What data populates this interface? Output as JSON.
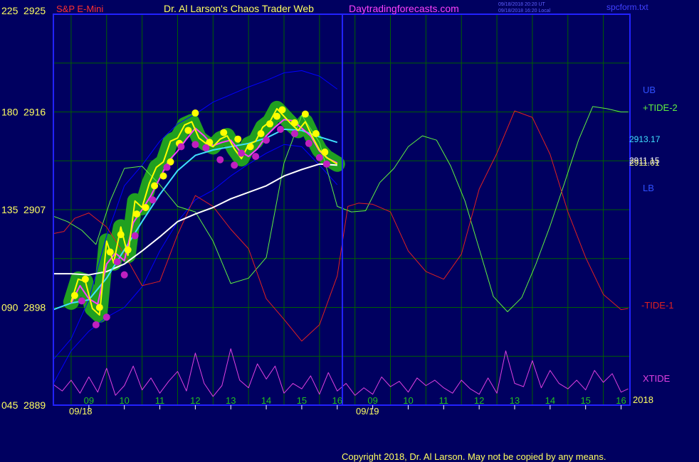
{
  "header": {
    "left_axis_top": "225",
    "price_top": "2925",
    "instrument": "S&P E-Mini",
    "title": "Dr. Al Larson's Chaos Trader Web",
    "site": "Daytradingforecasts.com",
    "timestamp_line1": "09/18/2018 20:20 UT",
    "timestamp_line2": "09/18/2018 16:20 Local",
    "filename": "spcform.txt"
  },
  "footer": {
    "copyright": "Copyright 2018, Dr. Al Larson. May not be copied by any means."
  },
  "colors": {
    "background": "#000060",
    "grid": "#006000",
    "frame": "#2222ff",
    "price": "#ffff00",
    "fast_avg": "#ff40ff",
    "cyan_avg": "#40e0ff",
    "white_avg": "#ffffff",
    "band": "#0000ff",
    "tide_plus": "#60f040",
    "tide_minus": "#e02020",
    "xtide": "#e040e0",
    "halo": "#20a020",
    "dot_yellow": "#ffff00",
    "dot_magenta": "#c020c0"
  },
  "chart_data": {
    "type": "line",
    "title": "S&P E-Mini",
    "y_left_ticks": [
      {
        "angle": "225",
        "price": "2925",
        "value": 2925
      },
      {
        "angle": "180",
        "price": "2916",
        "value": 2916
      },
      {
        "angle": "135",
        "price": "2907",
        "value": 2907
      },
      {
        "angle": "090",
        "price": "2898",
        "value": 2898
      },
      {
        "angle": "045",
        "price": "2889",
        "value": 2889
      }
    ],
    "ylim": [
      2889,
      2925
    ],
    "x_hour_ticks": [
      "09",
      "10",
      "11",
      "12",
      "13",
      "14",
      "15",
      "16",
      "09",
      "10",
      "11",
      "12",
      "13",
      "14",
      "15",
      "16"
    ],
    "x_dates": [
      "09/18",
      "09/19"
    ],
    "x_end_label": "2018",
    "right_labels": {
      "ub": "UB",
      "tide_plus": "+TIDE-2",
      "cyan_value": "2913.17",
      "white_value_a": "2911.15",
      "white_value_b": "2911.01",
      "lb": "LB",
      "tide_minus": "-TIDE-1",
      "xtide": "XTIDE"
    },
    "series": [
      {
        "name": "S&P E-Mini",
        "x": [
          8.5,
          8.7,
          8.9,
          9.1,
          9.3,
          9.5,
          9.7,
          9.9,
          10.1,
          10.3,
          10.5,
          10.7,
          10.9,
          11.1,
          11.3,
          11.5,
          11.7,
          11.9,
          12.1,
          12.3,
          12.5,
          12.7,
          12.9,
          13.1,
          13.3,
          13.5,
          13.7,
          13.9,
          14.1,
          14.3,
          14.5,
          14.7,
          14.9,
          15.1,
          15.3,
          15.5,
          15.7,
          15.9,
          16.0
        ],
        "values": [
          2898.5,
          2900.6,
          2900.4,
          2897.9,
          2897.3,
          2904.1,
          2902.1,
          2905.4,
          2902.8,
          2907.8,
          2907.2,
          2909.4,
          2910.9,
          2911.4,
          2913.3,
          2913.6,
          2914.8,
          2915.1,
          2913.6,
          2913.1,
          2912.8,
          2913.5,
          2913.8,
          2912.6,
          2911.7,
          2913.0,
          2913.3,
          2914.6,
          2915.1,
          2916.3,
          2915.6,
          2914.9,
          2914.3,
          2915.1,
          2913.7,
          2912.5,
          2911.8,
          2911.4,
          2911.2
        ]
      },
      {
        "name": "UB",
        "x": [
          8.0,
          8.5,
          9.0,
          9.5,
          10.0,
          10.5,
          11.0,
          11.5,
          12.0,
          12.5,
          13.0,
          13.5,
          14.0,
          14.5,
          15.0,
          15.5,
          16.0
        ],
        "values": [
          2893.2,
          2895.1,
          2898.7,
          2904.6,
          2909.2,
          2911.1,
          2913.3,
          2914.9,
          2915.8,
          2916.9,
          2917.6,
          2918.3,
          2918.9,
          2919.6,
          2919.8,
          2919.3,
          2918.1
        ]
      },
      {
        "name": "LB",
        "x": [
          8.0,
          8.5,
          9.0,
          9.5,
          10.0,
          10.5,
          11.0,
          11.5,
          12.0,
          12.5,
          13.0,
          13.5,
          14.0,
          14.5,
          15.0,
          15.5,
          16.0
        ],
        "values": [
          2891.0,
          2894.0,
          2895.8,
          2897.1,
          2898.0,
          2899.9,
          2903.2,
          2905.9,
          2907.9,
          2908.8,
          2910.1,
          2911.2,
          2912.2,
          2913.0,
          2912.8,
          2911.1,
          2909.3
        ]
      },
      {
        "name": "+TIDE-2",
        "x": [
          8.0,
          8.4,
          8.8,
          9.2,
          9.6,
          10.0,
          10.5,
          11.0,
          11.5,
          12.0,
          12.5,
          13.0,
          13.5,
          14.0,
          14.5,
          15.0,
          15.5,
          16.0,
          16.4,
          16.8,
          17.2,
          17.6,
          18.0,
          18.4,
          18.8,
          19.2,
          19.6,
          20.0,
          20.4,
          20.8,
          21.2,
          21.6,
          22.0,
          22.4,
          22.8,
          23.2,
          23.6,
          24.0,
          24.2
        ],
        "values": [
          2906.4,
          2905.9,
          2905.1,
          2903.8,
          2907.8,
          2910.8,
          2911.0,
          2909.3,
          2907.3,
          2906.8,
          2904.1,
          2900.2,
          2900.7,
          2902.6,
          2911.3,
          2915.7,
          2913.2,
          2907.3,
          2906.8,
          2906.9,
          2909.5,
          2910.8,
          2912.8,
          2913.8,
          2913.4,
          2911.0,
          2907.8,
          2903.4,
          2899.0,
          2897.6,
          2898.9,
          2902.0,
          2905.5,
          2909.4,
          2913.4,
          2916.5,
          2916.3,
          2916.0,
          2916.0
        ]
      },
      {
        "name": "-TIDE-1",
        "x": [
          8.0,
          8.3,
          8.6,
          9.0,
          9.5,
          10.0,
          10.5,
          11.0,
          11.5,
          12.0,
          12.5,
          13.0,
          13.5,
          14.0,
          14.5,
          15.0,
          15.5,
          16.0,
          16.3,
          16.6,
          17.0,
          17.5,
          18.0,
          18.5,
          19.0,
          19.5,
          20.0,
          20.5,
          21.0,
          21.5,
          22.0,
          22.5,
          23.0,
          23.5,
          24.0,
          24.2
        ],
        "values": [
          2904.8,
          2905.0,
          2906.2,
          2906.7,
          2905.4,
          2902.9,
          2900.0,
          2900.4,
          2904.7,
          2908.3,
          2907.3,
          2905.2,
          2903.4,
          2898.8,
          2896.9,
          2894.9,
          2896.4,
          2900.9,
          2907.3,
          2907.6,
          2907.5,
          2906.8,
          2903.2,
          2901.3,
          2900.6,
          2902.9,
          2908.9,
          2912.2,
          2916.1,
          2915.5,
          2912.1,
          2906.8,
          2902.6,
          2899.2,
          2897.8,
          2897.9
        ]
      },
      {
        "name": "XTIDE",
        "x": [
          8.0,
          8.25,
          8.5,
          8.75,
          9.0,
          9.25,
          9.5,
          9.75,
          10.0,
          10.25,
          10.5,
          10.75,
          11.0,
          11.25,
          11.5,
          11.75,
          12.0,
          12.25,
          12.5,
          12.75,
          13.0,
          13.25,
          13.5,
          13.75,
          14.0,
          14.25,
          14.5,
          14.75,
          15.0,
          15.25,
          15.5,
          15.75,
          16.0,
          16.25,
          16.5,
          16.75,
          17.0,
          17.25,
          17.5,
          17.75,
          18.0,
          18.25,
          18.5,
          18.75,
          19.0,
          19.25,
          19.5,
          19.75,
          20.0,
          20.25,
          20.5,
          20.75,
          21.0,
          21.25,
          21.5,
          21.75,
          22.0,
          22.25,
          22.5,
          22.75,
          23.0,
          23.25,
          23.5,
          23.75,
          24.0,
          24.2
        ],
        "values": [
          2890.9,
          2890.3,
          2891.3,
          2890.1,
          2891.6,
          2890.2,
          2892.4,
          2889.9,
          2890.8,
          2892.6,
          2890.4,
          2891.5,
          2890.1,
          2891.2,
          2892.1,
          2890.3,
          2893.8,
          2891.0,
          2889.8,
          2890.8,
          2894.2,
          2891.3,
          2890.6,
          2892.8,
          2891.4,
          2892.6,
          2890.1,
          2891.0,
          2890.5,
          2891.7,
          2890.0,
          2892.0,
          2890.3,
          2891.0,
          2889.9,
          2890.6,
          2890.0,
          2891.6,
          2890.7,
          2891.2,
          2890.2,
          2891.5,
          2890.8,
          2891.3,
          2890.6,
          2890.1,
          2891.3,
          2890.5,
          2890.0,
          2891.5,
          2890.1,
          2894.0,
          2891.0,
          2890.7,
          2893.1,
          2890.6,
          2892.2,
          2891.0,
          2890.5,
          2891.3,
          2890.4,
          2892.2,
          2891.1,
          2891.9,
          2890.2,
          2890.5
        ]
      },
      {
        "name": "cyan average",
        "x": [
          8.0,
          8.5,
          9.0,
          9.5,
          10.0,
          10.5,
          11.0,
          11.5,
          12.0,
          12.5,
          13.0,
          13.5,
          14.0,
          14.5,
          15.0,
          15.5,
          16.0
        ],
        "values": [
          2897.8,
          2898.4,
          2898.7,
          2900.7,
          2903.3,
          2905.9,
          2908.4,
          2910.6,
          2912.0,
          2912.5,
          2912.8,
          2913.1,
          2913.6,
          2914.4,
          2914.3,
          2913.7,
          2913.2
        ]
      },
      {
        "name": "white average",
        "x": [
          8.0,
          8.5,
          9.0,
          9.5,
          10.0,
          10.5,
          11.0,
          11.5,
          12.0,
          12.5,
          13.0,
          13.5,
          14.0,
          14.5,
          15.0,
          15.5,
          16.0
        ],
        "values": [
          2901.1,
          2901.1,
          2901.0,
          2901.3,
          2902.0,
          2903.2,
          2904.5,
          2905.9,
          2906.6,
          2907.2,
          2908.0,
          2908.6,
          2909.2,
          2910.1,
          2910.7,
          2911.2,
          2911.1
        ]
      },
      {
        "name": "magenta average",
        "x": [
          8.5,
          8.75,
          9.0,
          9.25,
          9.5,
          9.75,
          10.0,
          10.25,
          10.5,
          10.75,
          11.0,
          11.25,
          11.5,
          11.75,
          12.0,
          12.25,
          12.5,
          12.75,
          13.0,
          13.25,
          13.5,
          13.75,
          14.0,
          14.25,
          14.5,
          14.75,
          15.0,
          15.25,
          15.5,
          15.75,
          16.0
        ],
        "values": [
          2898.4,
          2900.0,
          2898.8,
          2898.3,
          2902.0,
          2903.0,
          2902.3,
          2905.8,
          2907.0,
          2908.3,
          2909.9,
          2911.5,
          2912.4,
          2913.5,
          2914.5,
          2913.8,
          2912.9,
          2913.2,
          2913.4,
          2912.4,
          2911.9,
          2912.6,
          2913.8,
          2914.6,
          2915.3,
          2915.2,
          2914.5,
          2913.8,
          2912.4,
          2911.7,
          2911.3
        ]
      },
      {
        "name": "yellow dots",
        "x": [
          8.6,
          8.9,
          9.3,
          9.6,
          9.9,
          10.1,
          10.35,
          10.6,
          10.85,
          11.1,
          11.3,
          11.55,
          11.8,
          12.0,
          12.4,
          12.8,
          13.2,
          13.55,
          13.85,
          14.1,
          14.3,
          14.45,
          14.8,
          15.1,
          15.4,
          15.65
        ],
        "values": [
          2899.1,
          2900.6,
          2898.0,
          2903.1,
          2904.7,
          2903.3,
          2906.6,
          2907.2,
          2909.2,
          2910.1,
          2911.4,
          2913.1,
          2914.3,
          2915.9,
          2913.2,
          2914.1,
          2913.5,
          2912.8,
          2914.0,
          2914.9,
          2915.6,
          2916.2,
          2915.0,
          2915.8,
          2914.0,
          2912.3
        ]
      },
      {
        "name": "magenta dots",
        "x": [
          8.8,
          9.2,
          9.5,
          9.8,
          10.0,
          10.3,
          10.8,
          11.2,
          11.6,
          12.0,
          12.3,
          12.7,
          13.1,
          13.3,
          13.7,
          14.0,
          14.4,
          14.8,
          15.2,
          15.5,
          15.7
        ],
        "values": [
          2898.6,
          2896.4,
          2897.1,
          2902.2,
          2901.0,
          2904.6,
          2907.9,
          2910.9,
          2912.8,
          2913.0,
          2912.7,
          2911.6,
          2911.1,
          2912.2,
          2911.9,
          2913.4,
          2914.4,
          2914.0,
          2913.1,
          2911.8,
          2911.2
        ]
      }
    ]
  }
}
